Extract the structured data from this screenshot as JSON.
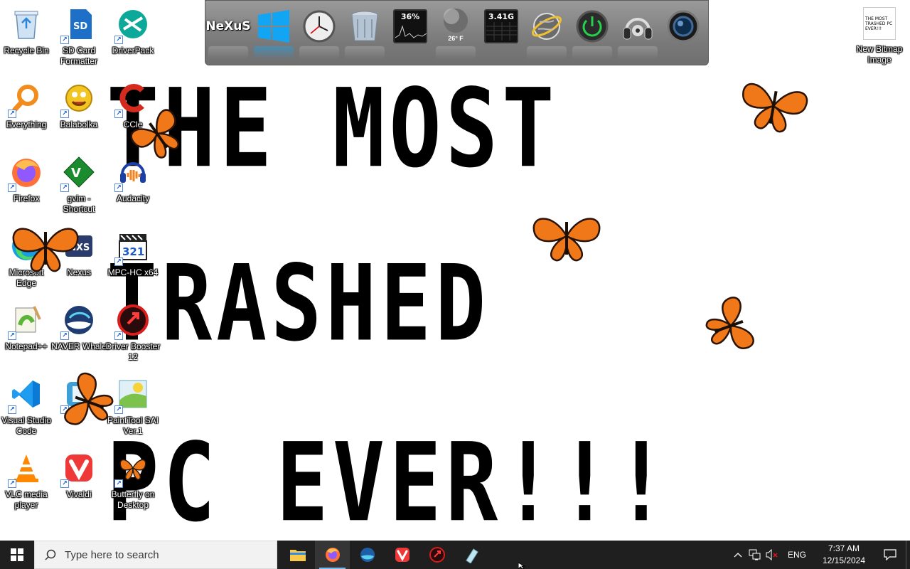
{
  "wallpaper": {
    "line1": "THE MOST",
    "line2": "TRASHED",
    "line3": "PC EVER!!!"
  },
  "desktop_icons": [
    {
      "label": "Recycle Bin",
      "icon": "recycle-bin-icon"
    },
    {
      "label": "SD Card Formatter",
      "icon": "sd-card-icon"
    },
    {
      "label": "DriverPack",
      "icon": "driverpack-icon"
    },
    {
      "label": "Everything",
      "icon": "everything-search-icon"
    },
    {
      "label": "Balabolka",
      "icon": "balabolka-icon"
    },
    {
      "label": "CCle",
      "icon": "ccleaner-icon"
    },
    {
      "label": "Firefox",
      "icon": "firefox-icon"
    },
    {
      "label": "gvim - Shortcut",
      "icon": "vim-icon"
    },
    {
      "label": "Audacity",
      "icon": "audacity-icon"
    },
    {
      "label": "Microsoft Edge",
      "icon": "edge-icon"
    },
    {
      "label": "Nexus",
      "icon": "nexus-icon"
    },
    {
      "label": "MPC-HC x64",
      "icon": "mpc-hc-icon"
    },
    {
      "label": "Notepad++",
      "icon": "notepadpp-icon"
    },
    {
      "label": "NAVER Whale",
      "icon": "naver-whale-icon"
    },
    {
      "label": "Driver Booster 12",
      "icon": "driver-booster-icon"
    },
    {
      "label": "Visual Studio Code",
      "icon": "vscode-icon"
    },
    {
      "label": "",
      "icon": "app-icon"
    },
    {
      "label": "PaintTool SAI Ver.1",
      "icon": "painttool-sai-icon"
    },
    {
      "label": "VLC media player",
      "icon": "vlc-icon"
    },
    {
      "label": "Vivaldi",
      "icon": "vivaldi-icon"
    },
    {
      "label": "Butterfly on Desktop",
      "icon": "butterfly-app-icon"
    },
    {
      "label": "New Bitmap Image",
      "icon": "bitmap-image-icon",
      "thumb_text": "THE MOST TRASHED PC EVER!!!"
    }
  ],
  "dock": {
    "items": [
      {
        "name": "nexus-logo",
        "text": "NeXuS"
      },
      {
        "name": "windows-start",
        "text": ""
      },
      {
        "name": "clock",
        "text": ""
      },
      {
        "name": "recycle-bin",
        "text": ""
      },
      {
        "name": "cpu-monitor",
        "text": "36%"
      },
      {
        "name": "weather",
        "text": "26° F"
      },
      {
        "name": "memory-monitor",
        "text": "3.41G"
      },
      {
        "name": "network",
        "text": ""
      },
      {
        "name": "power",
        "text": ""
      },
      {
        "name": "media-player",
        "text": ""
      },
      {
        "name": "camera",
        "text": ""
      }
    ]
  },
  "taskbar": {
    "search_placeholder": "Type here to search",
    "apps": [
      {
        "name": "file-explorer",
        "icon": "folder-icon"
      },
      {
        "name": "firefox",
        "icon": "firefox-icon",
        "active": true
      },
      {
        "name": "naver-whale",
        "icon": "naver-whale-icon"
      },
      {
        "name": "vivaldi",
        "icon": "vivaldi-icon"
      },
      {
        "name": "driver-booster",
        "icon": "driver-booster-icon"
      },
      {
        "name": "painttool-sai",
        "icon": "painttool-sai-icon"
      }
    ],
    "language": "ENG",
    "time": "7:37 AM",
    "date": "12/15/2024"
  },
  "colors": {
    "taskbar_bg": "#1f1f1f",
    "accent": "#76b9ed",
    "dock_bg": "#8a8a8a",
    "butterfly_orange": "#f07818"
  }
}
